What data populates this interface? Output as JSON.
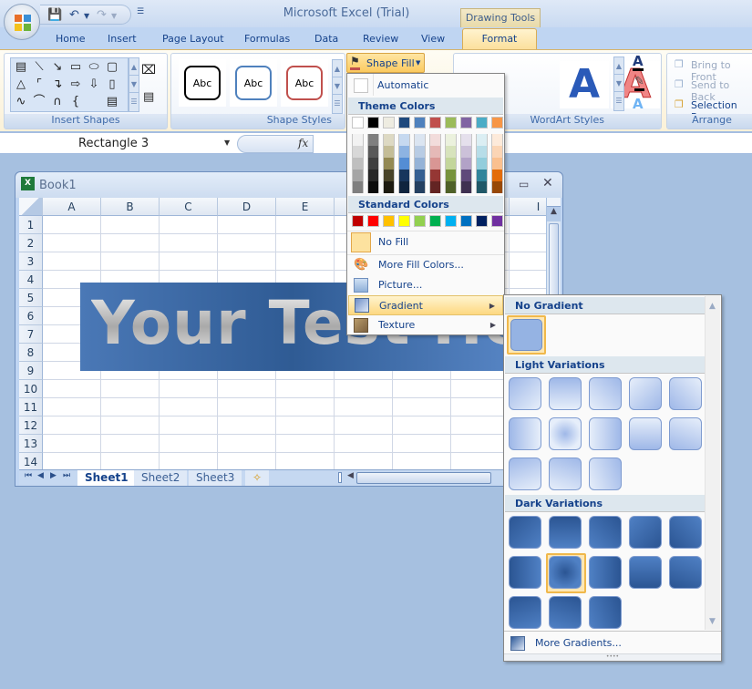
{
  "window": {
    "title": "Microsoft Excel (Trial)",
    "contextual_tab_group": "Drawing Tools"
  },
  "quick_access": {
    "save": "save-icon",
    "undo": "undo-icon",
    "redo": "redo-icon",
    "customize": "customize-icon"
  },
  "tabs": [
    {
      "label": "Home"
    },
    {
      "label": "Insert"
    },
    {
      "label": "Page Layout"
    },
    {
      "label": "Formulas"
    },
    {
      "label": "Data"
    },
    {
      "label": "Review"
    },
    {
      "label": "View"
    },
    {
      "label": "Format",
      "active": true
    }
  ],
  "ribbon": {
    "groups": {
      "insert_shapes": "Insert Shapes",
      "shape_styles": "Shape Styles",
      "wordart_styles": "WordArt Styles",
      "arrange": "Arrange"
    },
    "shape_style_previews": [
      {
        "label": "Abc",
        "border": "#000000"
      },
      {
        "label": "Abc",
        "border": "#4f81bd"
      },
      {
        "label": "Abc",
        "border": "#c0504d"
      }
    ],
    "shape_fill": "Shape Fill",
    "arrange_items": [
      "Bring to Front",
      "Send to Back",
      "Selection Pane"
    ]
  },
  "formula_bar": {
    "name_box": "Rectangle 3",
    "fx": "fx",
    "formula": ""
  },
  "workbook": {
    "title": "Book1",
    "columns": [
      "A",
      "B",
      "C",
      "D",
      "E",
      "F",
      "G",
      "H",
      "I"
    ],
    "rows": [
      "1",
      "2",
      "3",
      "4",
      "5",
      "6",
      "7",
      "8",
      "9",
      "10",
      "11",
      "12",
      "13",
      "14"
    ],
    "sheets": [
      {
        "label": "Sheet1",
        "active": true
      },
      {
        "label": "Sheet2"
      },
      {
        "label": "Sheet3"
      }
    ]
  },
  "wordart": {
    "text": "Your Test Here"
  },
  "shape_fill_menu": {
    "automatic": "Automatic",
    "theme_colors_header": "Theme Colors",
    "theme_top": [
      "#ffffff",
      "#000000",
      "#eeece1",
      "#1f497d",
      "#4f81bd",
      "#c0504d",
      "#9bbb59",
      "#8064a2",
      "#4bacc6",
      "#f79646"
    ],
    "theme_shades": [
      [
        "#f2f2f2",
        "#d8d8d8",
        "#bfbfbf",
        "#a5a5a5",
        "#7f7f7f"
      ],
      [
        "#7f7f7f",
        "#595959",
        "#3f3f3f",
        "#262626",
        "#0c0c0c"
      ],
      [
        "#ddd9c3",
        "#c4bd97",
        "#938953",
        "#494429",
        "#1d1b10"
      ],
      [
        "#c6d9f0",
        "#8db3e2",
        "#548dd4",
        "#17365d",
        "#0f243e"
      ],
      [
        "#dbe5f1",
        "#b8cce4",
        "#95b3d7",
        "#366092",
        "#244061"
      ],
      [
        "#f2dcdb",
        "#e5b9b7",
        "#d99694",
        "#953734",
        "#632423"
      ],
      [
        "#ebf1dd",
        "#d7e3bc",
        "#c3d69b",
        "#76923c",
        "#4f6128"
      ],
      [
        "#e5e0ec",
        "#ccc1d9",
        "#b2a2c7",
        "#5f497a",
        "#3f3151"
      ],
      [
        "#dbeef3",
        "#b7dde8",
        "#92cddc",
        "#31859b",
        "#205867"
      ],
      [
        "#fdeada",
        "#fbd5b5",
        "#fac08f",
        "#e36c09",
        "#974806"
      ]
    ],
    "standard_colors_header": "Standard Colors",
    "standard_colors": [
      "#c00000",
      "#ff0000",
      "#ffc000",
      "#ffff00",
      "#92d050",
      "#00b050",
      "#00b0f0",
      "#0070c0",
      "#002060",
      "#7030a0"
    ],
    "items": [
      {
        "label": "No Fill",
        "icon": "no-fill-icon"
      },
      {
        "label": "More Fill Colors...",
        "icon": "palette-icon"
      },
      {
        "label": "Picture...",
        "icon": "picture-icon"
      },
      {
        "label": "Gradient",
        "icon": "gradient-icon",
        "highlighted": true,
        "submenu": true
      },
      {
        "label": "Texture",
        "icon": "texture-icon",
        "submenu": true
      }
    ]
  },
  "gradient_menu": {
    "no_gradient_header": "No Gradient",
    "light_header": "Light Variations",
    "dark_header": "Dark Variations",
    "light_count": 13,
    "dark_count": 13,
    "selected_dark_index": 6,
    "more": "More Gradients..."
  }
}
